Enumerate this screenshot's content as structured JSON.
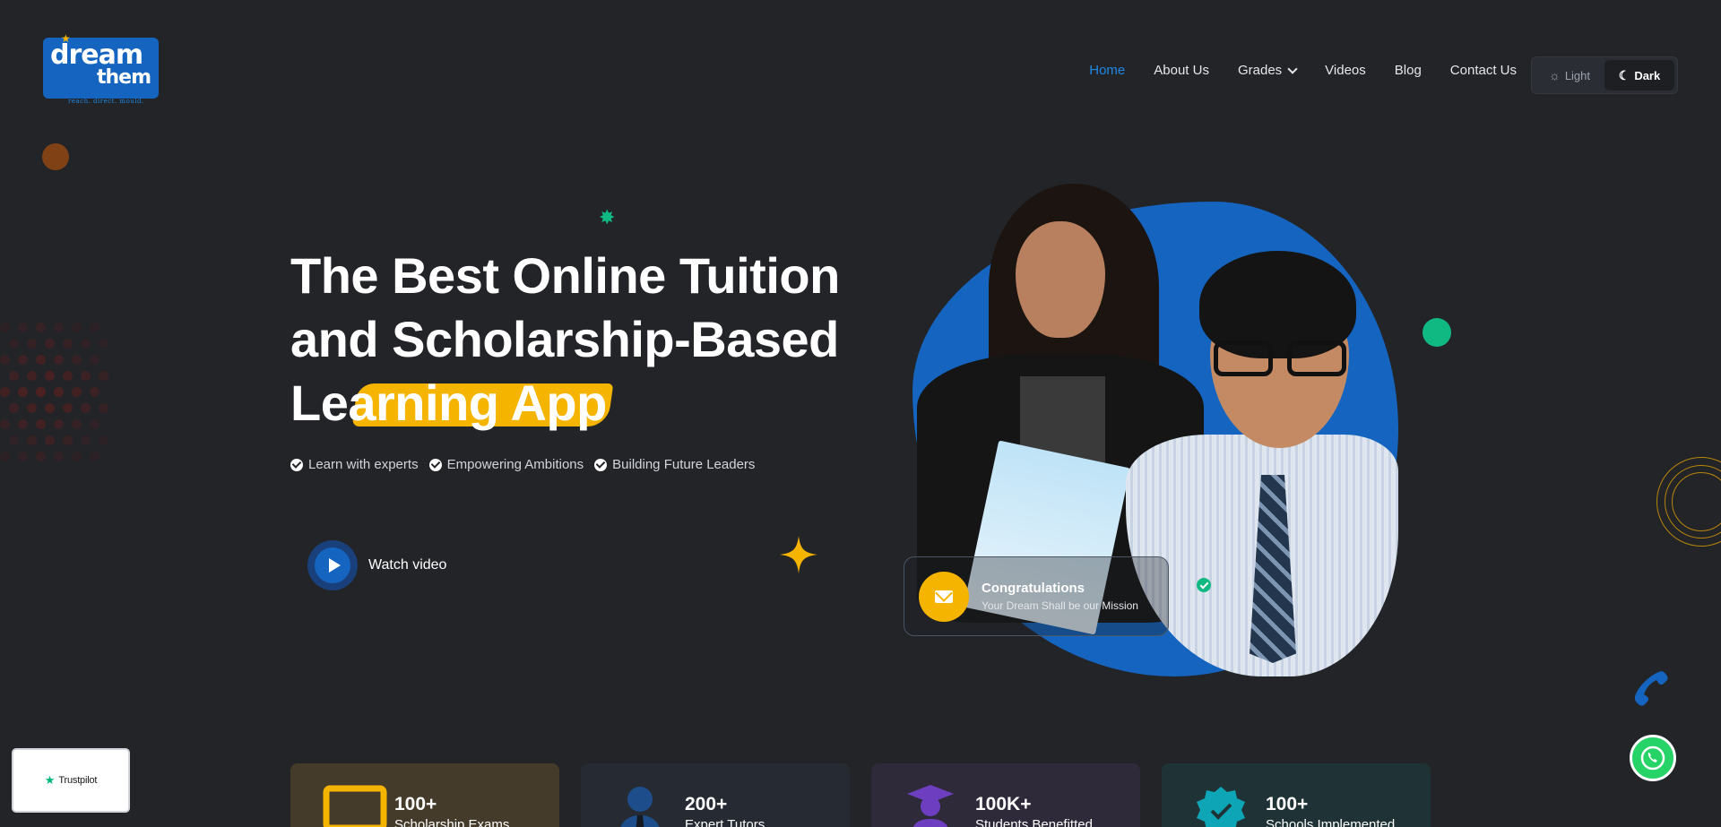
{
  "logo": {
    "line1": "dream",
    "line2": "them",
    "tagline": "reach. direct. mould."
  },
  "nav": {
    "items": [
      {
        "label": "Home",
        "active": true
      },
      {
        "label": "About Us"
      },
      {
        "label": "Grades",
        "dropdown": true
      },
      {
        "label": "Videos"
      },
      {
        "label": "Blog"
      },
      {
        "label": "Contact Us"
      }
    ]
  },
  "theme_toggle": {
    "light_label": "Light",
    "dark_label": "Dark",
    "selected": "Dark"
  },
  "hero": {
    "title_line1": "The Best Online Tuition",
    "title_line2": "and Scholarship-Based",
    "title_line3_start": "L",
    "title_line3_highlight": "earning App",
    "features": [
      "Learn with experts",
      "Empowering Ambitions",
      "Building Future Leaders"
    ],
    "watch_label": "Watch video"
  },
  "congrats_card": {
    "title": "Congratulations",
    "subtitle": "Your Dream Shall be our Mission"
  },
  "trustpilot": {
    "label": "Trustpilot"
  },
  "stats": [
    {
      "number": "100+",
      "label": "Scholarship Exams",
      "icon": "monitor-icon",
      "bg": "#453b2a",
      "color": "#f5b400"
    },
    {
      "number": "200+",
      "label": "Expert Tutors",
      "icon": "tutor-icon",
      "bg": "#252a33",
      "color": "#1e4d8c"
    },
    {
      "number": "100K+",
      "label": "Students Benefitted",
      "icon": "graduate-icon",
      "bg": "#2f2a3a",
      "color": "#6d3fc0"
    },
    {
      "number": "100+",
      "label": "Schools Implemented",
      "icon": "badge-check-icon",
      "bg": "#1f3336",
      "color": "#0ea5b7"
    }
  ],
  "colors": {
    "background": "#222428",
    "accent_blue": "#1565c0",
    "accent_yellow": "#f5b400",
    "accent_green": "#10b981"
  }
}
